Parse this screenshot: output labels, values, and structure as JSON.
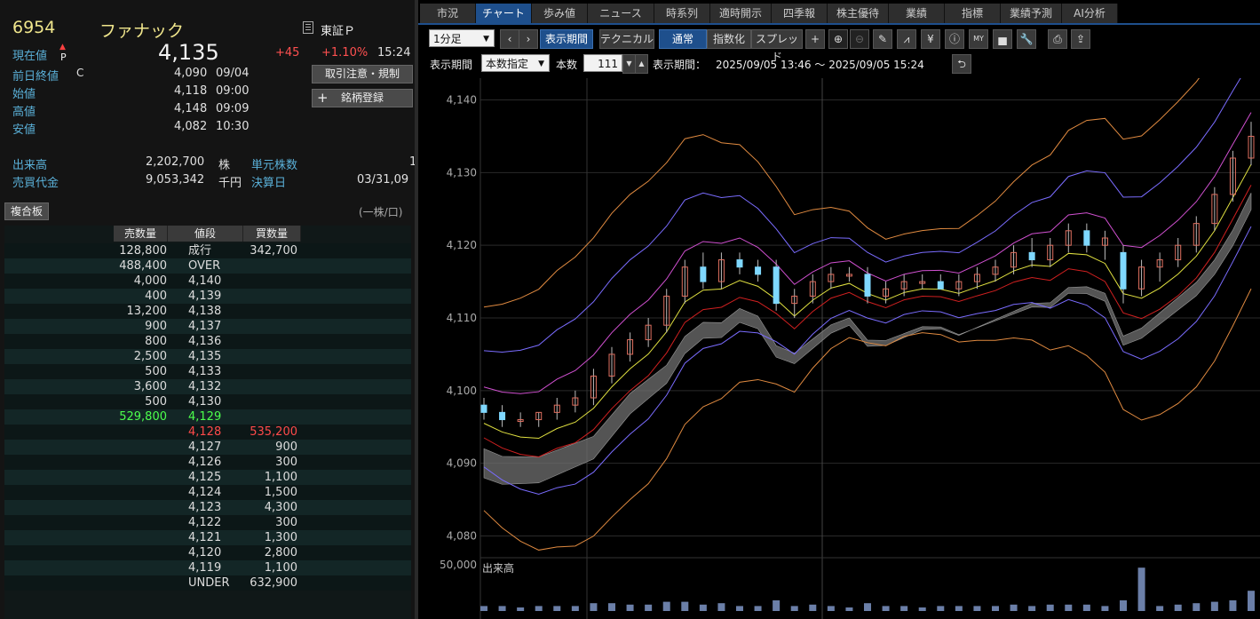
{
  "stock": {
    "code": "6954",
    "name": "ファナック",
    "market": "東証Ｐ",
    "market_icon": "document-icon",
    "market_flag": "P"
  },
  "quote": {
    "current_label": "現在値",
    "current_value": "4,135",
    "change": "+45",
    "change_pct": "+1.10%",
    "time": "15:24",
    "prev_close_label": "前日終値",
    "prev_close_flag": "C",
    "prev_close": "4,090",
    "prev_close_date": "09/04",
    "open_label": "始値",
    "open": "4,118",
    "open_time": "09:00",
    "high_label": "高値",
    "high": "4,148",
    "high_time": "09:09",
    "low_label": "安値",
    "low": "4,082",
    "low_time": "10:30",
    "volume_label": "出来高",
    "volume": "2,202,700",
    "volume_unit": "株",
    "turnover_label": "売買代金",
    "turnover": "9,053,342",
    "turnover_unit": "千円",
    "unit_label": "単元株数",
    "unit_value": "1",
    "settle_label": "決算日",
    "settle_date": "03/31,09"
  },
  "buttons": {
    "caution": "取引注意・規制",
    "register": "銘柄登録",
    "register_icon": "plus-icon",
    "board": "複合板",
    "per_share": "(一株/口)"
  },
  "order_book": {
    "headers": [
      "売数量",
      "値段",
      "買数量"
    ],
    "rows": [
      {
        "sell": "128,800",
        "price": "成行",
        "buy": "342,700"
      },
      {
        "sell": "488,400",
        "price": "OVER",
        "buy": ""
      },
      {
        "sell": "4,000",
        "price": "4,140",
        "buy": ""
      },
      {
        "sell": "400",
        "price": "4,139",
        "buy": ""
      },
      {
        "sell": "13,200",
        "price": "4,138",
        "buy": ""
      },
      {
        "sell": "900",
        "price": "4,137",
        "buy": ""
      },
      {
        "sell": "800",
        "price": "4,136",
        "buy": ""
      },
      {
        "sell": "2,500",
        "price": "4,135",
        "buy": ""
      },
      {
        "sell": "500",
        "price": "4,133",
        "buy": ""
      },
      {
        "sell": "3,600",
        "price": "4,132",
        "buy": ""
      },
      {
        "sell": "500",
        "price": "4,130",
        "buy": ""
      },
      {
        "sell": "529,800",
        "price": "4,129",
        "buy": "",
        "highlight": "green"
      },
      {
        "sell": "",
        "price": "4,128",
        "buy": "535,200",
        "highlight": "red"
      },
      {
        "sell": "",
        "price": "4,127",
        "buy": "900"
      },
      {
        "sell": "",
        "price": "4,126",
        "buy": "300"
      },
      {
        "sell": "",
        "price": "4,125",
        "buy": "1,100"
      },
      {
        "sell": "",
        "price": "4,124",
        "buy": "1,500"
      },
      {
        "sell": "",
        "price": "4,123",
        "buy": "4,300"
      },
      {
        "sell": "",
        "price": "4,122",
        "buy": "300"
      },
      {
        "sell": "",
        "price": "4,121",
        "buy": "1,300"
      },
      {
        "sell": "",
        "price": "4,120",
        "buy": "2,800"
      },
      {
        "sell": "",
        "price": "4,119",
        "buy": "1,100"
      },
      {
        "sell": "",
        "price": "UNDER",
        "buy": "632,900"
      }
    ]
  },
  "tabs": [
    "市況",
    "チャート",
    "歩み値",
    "ニュース",
    "時系列",
    "適時開示",
    "四季報",
    "株主優待",
    "業績",
    "指標",
    "業績予測",
    "AI分析"
  ],
  "active_tab": "チャート",
  "toolbar": {
    "interval": "1分足",
    "period_btn": "表示期間",
    "technical_btn": "テクニカル",
    "normal_btn": "通常",
    "index_btn": "指数化",
    "spread_btn": "スプレッド",
    "icons": [
      "crosshair-icon",
      "zoom-in-icon",
      "zoom-out-icon",
      "pencil-icon",
      "trend-icon",
      "yen-icon",
      "info-icon",
      "my-indicator-icon",
      "volume-profile-icon",
      "wrench-icon",
      "print-icon",
      "export-icon"
    ]
  },
  "period_bar": {
    "label": "表示期間",
    "mode": "本数指定",
    "count_label": "本数",
    "count": "111",
    "range_label": "表示期間：",
    "range": "2025/09/05 13:46 ～ 2025/09/05 15:24"
  },
  "chart_data": {
    "type": "line",
    "y_ticks": [
      "4,140",
      "4,130",
      "4,120",
      "4,110",
      "4,100",
      "4,090",
      "4,080"
    ],
    "ylim": [
      4077,
      4143
    ],
    "volume_label": "出来高",
    "volume_tick": "50,000",
    "candles": [
      {
        "o": 4098,
        "h": 4099,
        "l": 4096,
        "c": 4097
      },
      {
        "o": 4097,
        "h": 4098,
        "l": 4095,
        "c": 4096
      },
      {
        "o": 4096,
        "h": 4097,
        "l": 4095,
        "c": 4096
      },
      {
        "o": 4096,
        "h": 4097,
        "l": 4095,
        "c": 4097
      },
      {
        "o": 4097,
        "h": 4099,
        "l": 4096,
        "c": 4098
      },
      {
        "o": 4098,
        "h": 4100,
        "l": 4097,
        "c": 4099
      },
      {
        "o": 4099,
        "h": 4103,
        "l": 4098,
        "c": 4102
      },
      {
        "o": 4102,
        "h": 4106,
        "l": 4101,
        "c": 4105
      },
      {
        "o": 4105,
        "h": 4108,
        "l": 4104,
        "c": 4107
      },
      {
        "o": 4107,
        "h": 4110,
        "l": 4106,
        "c": 4109
      },
      {
        "o": 4109,
        "h": 4114,
        "l": 4108,
        "c": 4113
      },
      {
        "o": 4113,
        "h": 4118,
        "l": 4112,
        "c": 4117
      },
      {
        "o": 4117,
        "h": 4119,
        "l": 4114,
        "c": 4115
      },
      {
        "o": 4115,
        "h": 4119,
        "l": 4114,
        "c": 4118
      },
      {
        "o": 4118,
        "h": 4119,
        "l": 4116,
        "c": 4117
      },
      {
        "o": 4117,
        "h": 4118,
        "l": 4115,
        "c": 4116
      },
      {
        "o": 4117,
        "h": 4118,
        "l": 4111,
        "c": 4112
      },
      {
        "o": 4112,
        "h": 4114,
        "l": 4110,
        "c": 4113
      },
      {
        "o": 4113,
        "h": 4116,
        "l": 4112,
        "c": 4115
      },
      {
        "o": 4115,
        "h": 4117,
        "l": 4114,
        "c": 4116
      },
      {
        "o": 4116,
        "h": 4117,
        "l": 4115,
        "c": 4116
      },
      {
        "o": 4116,
        "h": 4117,
        "l": 4112,
        "c": 4113
      },
      {
        "o": 4113,
        "h": 4115,
        "l": 4112,
        "c": 4114
      },
      {
        "o": 4114,
        "h": 4116,
        "l": 4113,
        "c": 4115
      },
      {
        "o": 4115,
        "h": 4116,
        "l": 4114,
        "c": 4115
      },
      {
        "o": 4115,
        "h": 4116,
        "l": 4114,
        "c": 4114
      },
      {
        "o": 4114,
        "h": 4116,
        "l": 4113,
        "c": 4115
      },
      {
        "o": 4115,
        "h": 4117,
        "l": 4114,
        "c": 4116
      },
      {
        "o": 4116,
        "h": 4118,
        "l": 4115,
        "c": 4117
      },
      {
        "o": 4117,
        "h": 4120,
        "l": 4116,
        "c": 4119
      },
      {
        "o": 4119,
        "h": 4121,
        "l": 4117,
        "c": 4118
      },
      {
        "o": 4118,
        "h": 4121,
        "l": 4117,
        "c": 4120
      },
      {
        "o": 4120,
        "h": 4123,
        "l": 4119,
        "c": 4122
      },
      {
        "o": 4122,
        "h": 4123,
        "l": 4119,
        "c": 4120
      },
      {
        "o": 4120,
        "h": 4122,
        "l": 4118,
        "c": 4121
      },
      {
        "o": 4119,
        "h": 4120,
        "l": 4112,
        "c": 4114
      },
      {
        "o": 4114,
        "h": 4118,
        "l": 4113,
        "c": 4117
      },
      {
        "o": 4117,
        "h": 4119,
        "l": 4115,
        "c": 4118
      },
      {
        "o": 4118,
        "h": 4121,
        "l": 4117,
        "c": 4120
      },
      {
        "o": 4120,
        "h": 4124,
        "l": 4119,
        "c": 4123
      },
      {
        "o": 4123,
        "h": 4128,
        "l": 4122,
        "c": 4127
      },
      {
        "o": 4127,
        "h": 4133,
        "l": 4126,
        "c": 4132
      },
      {
        "o": 4132,
        "h": 4137,
        "l": 4131,
        "c": 4135
      }
    ]
  }
}
